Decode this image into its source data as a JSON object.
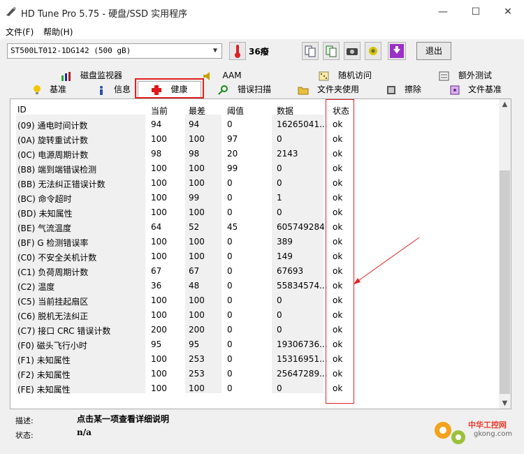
{
  "window": {
    "title": "HD Tune Pro 5.75 - 硬盘/SSD 实用程序",
    "minimize": "—",
    "maximize": "☐",
    "close": "✕"
  },
  "menu": [
    {
      "label": "文件(F)"
    },
    {
      "label": "帮助(H)"
    }
  ],
  "toolbar": {
    "drive": "ST500LT012-1DG142 (500 gB)",
    "temperature": "36癈",
    "exit_label": "退出"
  },
  "tabs_top": [
    {
      "label": "磁盘监视器",
      "icon": "bar-chart-icon"
    },
    {
      "label": "AAM",
      "icon": "speaker-icon"
    },
    {
      "label": "随机访问",
      "icon": "random-access-icon"
    },
    {
      "label": "额外测试",
      "icon": "extra-test-icon"
    }
  ],
  "tabs_bottom": [
    {
      "label": "基准",
      "icon": "bulb-icon"
    },
    {
      "label": "信息",
      "icon": "info-icon"
    },
    {
      "label": "健康",
      "icon": "health-cross-icon",
      "active": true
    },
    {
      "label": "错误扫描",
      "icon": "magnifier-icon"
    },
    {
      "label": "文件夹使用",
      "icon": "folder-icon"
    },
    {
      "label": "擦除",
      "icon": "eraser-icon"
    },
    {
      "label": "文件基准",
      "icon": "file-benchmark-icon"
    }
  ],
  "table": {
    "headers": [
      "ID",
      "当前",
      "最差",
      "阈值",
      "数据",
      "状态"
    ],
    "rows": [
      [
        "(09) 通电时间计数",
        "94",
        "94",
        "0",
        "16265041...",
        "ok"
      ],
      [
        "(0A) 旋转重试计数",
        "100",
        "100",
        "97",
        "0",
        "ok"
      ],
      [
        "(0C) 电源周期计数",
        "98",
        "98",
        "20",
        "2143",
        "ok"
      ],
      [
        "(B8) 端到端错误检测",
        "100",
        "100",
        "99",
        "0",
        "ok"
      ],
      [
        "(BB) 无法纠正错误计数",
        "100",
        "100",
        "0",
        "0",
        "ok"
      ],
      [
        "(BC) 命令超时",
        "100",
        "99",
        "0",
        "1",
        "ok"
      ],
      [
        "(BD) 未知属性",
        "100",
        "100",
        "0",
        "0",
        "ok"
      ],
      [
        "(BE) 气流温度",
        "64",
        "52",
        "45",
        "605749284",
        "ok"
      ],
      [
        "(BF) G 检测错误率",
        "100",
        "100",
        "0",
        "389",
        "ok"
      ],
      [
        "(C0) 不安全关机计数",
        "100",
        "100",
        "0",
        "149",
        "ok"
      ],
      [
        "(C1) 负荷周期计数",
        "67",
        "67",
        "0",
        "67693",
        "ok"
      ],
      [
        "(C2) 温度",
        "36",
        "48",
        "0",
        "55834574...",
        "ok"
      ],
      [
        "(C5) 当前挂起扇区",
        "100",
        "100",
        "0",
        "0",
        "ok"
      ],
      [
        "(C6) 脱机无法纠正",
        "100",
        "100",
        "0",
        "0",
        "ok"
      ],
      [
        "(C7) 接口 CRC 错误计数",
        "200",
        "200",
        "0",
        "0",
        "ok"
      ],
      [
        "(F0) 磁头飞行小时",
        "95",
        "95",
        "0",
        "19306736...",
        "ok"
      ],
      [
        "(F1) 未知属性",
        "100",
        "253",
        "0",
        "15316951...",
        "ok"
      ],
      [
        "(F2) 未知属性",
        "100",
        "253",
        "0",
        "25647289...",
        "ok"
      ],
      [
        "(FE) 未知属性",
        "100",
        "100",
        "0",
        "0",
        "ok"
      ]
    ]
  },
  "details": {
    "desc_label": "描述:",
    "desc_value": "点击某一项查看详细说明",
    "status_label": "状态:",
    "status_value": "n/a"
  },
  "watermark": {
    "text": "中华工控网",
    "url": "gkong.com"
  },
  "colors": {
    "highlight": "#e02020",
    "col_shade": "#f0f0f0"
  }
}
